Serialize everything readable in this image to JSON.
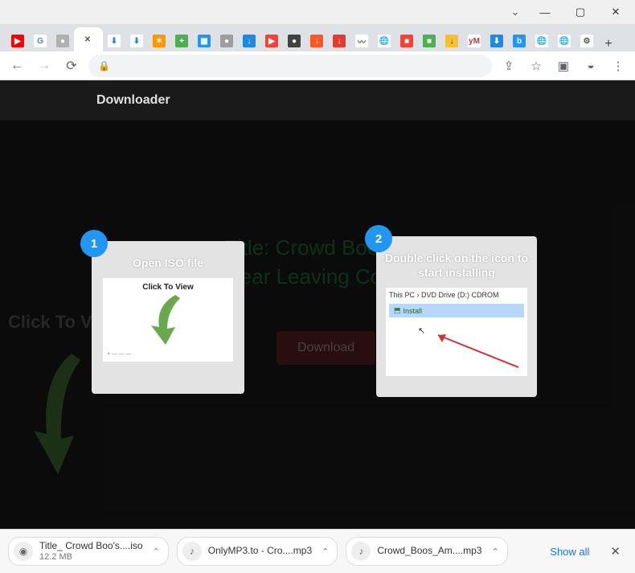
{
  "window": {
    "controls": [
      "dropdown",
      "minimize",
      "maximize",
      "close"
    ]
  },
  "tabs": {
    "favicons": [
      {
        "name": "youtube-icon",
        "bg": "#ff0000",
        "fg": "#fff",
        "glyph": "▶"
      },
      {
        "name": "google-icon",
        "bg": "#fff",
        "fg": "#4285f4",
        "glyph": "G"
      },
      {
        "name": "generic-gray-icon",
        "bg": "#b0b0b0",
        "fg": "#fff",
        "glyph": "●"
      },
      {
        "name": "close-icon",
        "bg": "#fff",
        "fg": "#555",
        "glyph": "✕",
        "active": true
      },
      {
        "name": "cloud-down-icon",
        "bg": "#fff",
        "fg": "#1e88e5",
        "glyph": "⬇"
      },
      {
        "name": "cloud-down-icon-2",
        "bg": "#fff",
        "fg": "#1e88e5",
        "glyph": "⬇"
      },
      {
        "name": "orange-burst-icon",
        "bg": "#ff9800",
        "fg": "#fff",
        "glyph": "✶"
      },
      {
        "name": "green-plus-icon",
        "bg": "#4caf50",
        "fg": "#fff",
        "glyph": "+"
      },
      {
        "name": "blue-grid-icon",
        "bg": "#2196f3",
        "fg": "#fff",
        "glyph": "▦"
      },
      {
        "name": "gray-circle-icon",
        "bg": "#9e9e9e",
        "fg": "#fff",
        "glyph": "●"
      },
      {
        "name": "down-arrow-icon",
        "bg": "#1e88e5",
        "fg": "#fff",
        "glyph": "↓"
      },
      {
        "name": "red-play-icon",
        "bg": "#f44336",
        "fg": "#fff",
        "glyph": "▶"
      },
      {
        "name": "dark-circle-icon",
        "bg": "#424242",
        "fg": "#fff",
        "glyph": "●"
      },
      {
        "name": "orange-down-icon",
        "bg": "#ff5722",
        "fg": "#fff",
        "glyph": "↓"
      },
      {
        "name": "red-down-icon",
        "bg": "#e53935",
        "fg": "#fff",
        "glyph": "↓"
      },
      {
        "name": "curve-icon",
        "bg": "#fff",
        "fg": "#555",
        "glyph": "〰"
      },
      {
        "name": "globe-icon",
        "bg": "#fff",
        "fg": "#555",
        "glyph": "🌐"
      },
      {
        "name": "red-square-icon",
        "bg": "#f44336",
        "fg": "#fff",
        "glyph": "■"
      },
      {
        "name": "green-square-icon",
        "bg": "#4caf50",
        "fg": "#fff",
        "glyph": "■"
      },
      {
        "name": "yellow-down-icon",
        "bg": "#fbc02d",
        "fg": "#333",
        "glyph": "↓"
      },
      {
        "name": "y-m-icon",
        "bg": "#fff",
        "fg": "#d32f2f",
        "glyph": "yM"
      },
      {
        "name": "blue-down-icon",
        "bg": "#1e88e5",
        "fg": "#fff",
        "glyph": "⬇"
      },
      {
        "name": "blue-b-icon",
        "bg": "#2196f3",
        "fg": "#fff",
        "glyph": "b"
      },
      {
        "name": "globe-icon-2",
        "bg": "#fff",
        "fg": "#555",
        "glyph": "🌐"
      },
      {
        "name": "globe-icon-3",
        "bg": "#fff",
        "fg": "#555",
        "glyph": "🌐"
      },
      {
        "name": "gear-icon",
        "bg": "#fff",
        "fg": "#555",
        "glyph": "⚙"
      }
    ]
  },
  "addressbar": {
    "actions": [
      "share",
      "star",
      "panel",
      "profile",
      "menu"
    ]
  },
  "site": {
    "header_title": "Downloader",
    "click_to_view": "Click To View",
    "main_title": "Title: Crowd Boo's Amber Hear Leaving CourtDur...",
    "download_btn": "Download"
  },
  "overlay": {
    "steps": [
      {
        "num": "1",
        "title": "Open ISO file",
        "thumb_caption": "Click To View"
      },
      {
        "num": "2",
        "title": "Double click on the icon to start installing",
        "breadcrumb": "This PC › DVD Drive (D:) CDROM",
        "install_label": "Install"
      }
    ]
  },
  "shelf": {
    "items": [
      {
        "name": "Title_ Crowd Boo's....iso",
        "sub": "12.2 MB",
        "icon": "disc-icon"
      },
      {
        "name": "OnlyMP3.to - Cro....mp3",
        "sub": "",
        "icon": "audio-icon"
      },
      {
        "name": "Crowd_Boos_Am....mp3",
        "sub": "",
        "icon": "audio-icon"
      }
    ],
    "show_all": "Show all"
  }
}
